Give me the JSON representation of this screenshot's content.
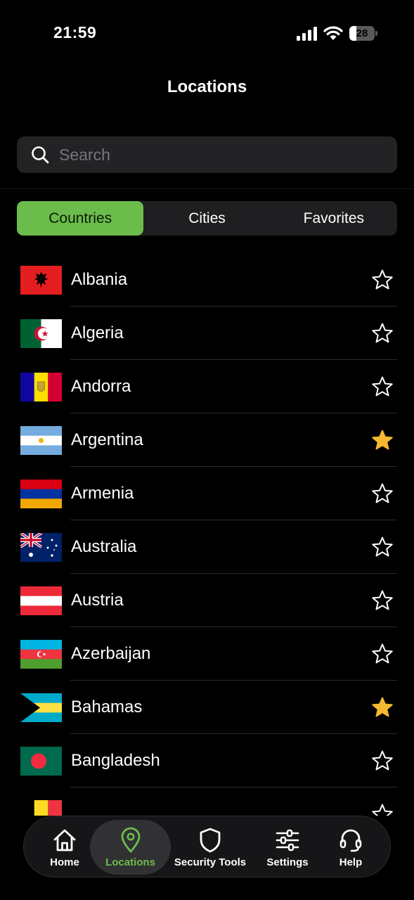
{
  "status_bar": {
    "time": "21:59",
    "battery_percent": "28",
    "signal_icon": "cellular-signal-icon",
    "wifi_icon": "wifi-icon"
  },
  "header": {
    "title": "Locations"
  },
  "search": {
    "placeholder": "Search",
    "icon": "search-icon"
  },
  "segments": [
    {
      "label": "Countries",
      "active": true
    },
    {
      "label": "Cities",
      "active": false
    },
    {
      "label": "Favorites",
      "active": false
    }
  ],
  "countries": [
    {
      "name": "Albania",
      "favorite": false
    },
    {
      "name": "Algeria",
      "favorite": false
    },
    {
      "name": "Andorra",
      "favorite": false
    },
    {
      "name": "Argentina",
      "favorite": true
    },
    {
      "name": "Armenia",
      "favorite": false
    },
    {
      "name": "Australia",
      "favorite": false
    },
    {
      "name": "Austria",
      "favorite": false
    },
    {
      "name": "Azerbaijan",
      "favorite": false
    },
    {
      "name": "Bahamas",
      "favorite": true
    },
    {
      "name": "Bangladesh",
      "favorite": false
    },
    {
      "name": "",
      "favorite": false
    }
  ],
  "tabs": [
    {
      "label": "Home",
      "icon": "home-icon",
      "active": false
    },
    {
      "label": "Locations",
      "icon": "location-pin-icon",
      "active": true
    },
    {
      "label": "Security Tools",
      "icon": "shield-icon",
      "active": false
    },
    {
      "label": "Settings",
      "icon": "sliders-icon",
      "active": false
    },
    {
      "label": "Help",
      "icon": "headset-icon",
      "active": false
    }
  ],
  "colors": {
    "accent": "#6cbc4c",
    "favorite_star": "#f5b82e",
    "background": "#000000",
    "surface": "#232325"
  }
}
